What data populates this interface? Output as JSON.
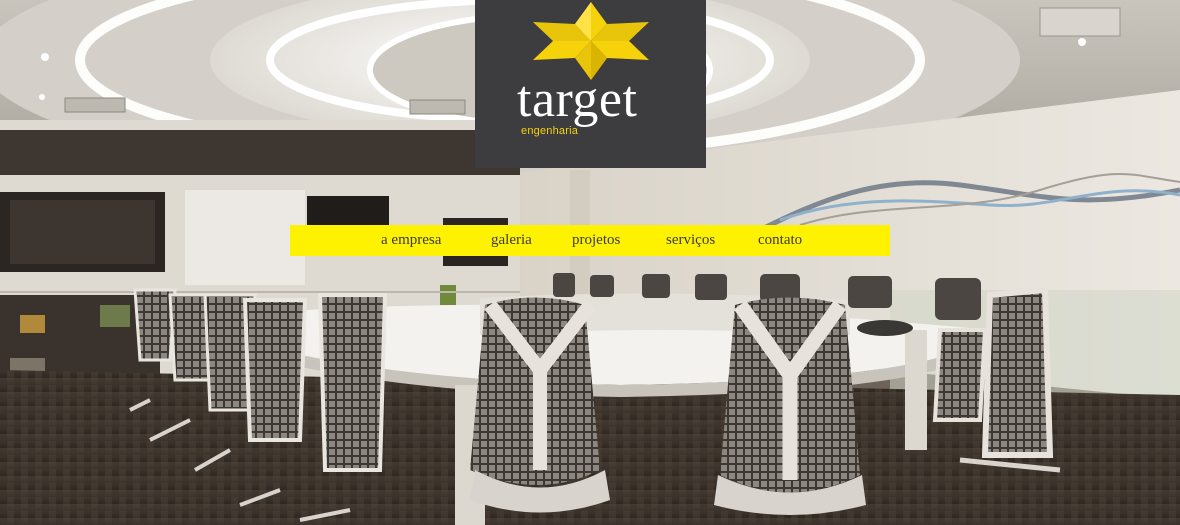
{
  "brand": {
    "name": "target",
    "subtitle": "engenharia",
    "logo_icon": "four-point-star-icon",
    "colors": {
      "logo_background": "#3d3c3e",
      "logo_accent": "#f5d20a",
      "nav_background": "#fff200",
      "nav_text": "#3a3a3a"
    }
  },
  "nav": {
    "items": [
      {
        "label": "a empresa"
      },
      {
        "label": "galeria"
      },
      {
        "label": "projetos"
      },
      {
        "label": "serviços"
      },
      {
        "label": "contato"
      }
    ]
  },
  "hero": {
    "scene": "conference-room-photo"
  }
}
